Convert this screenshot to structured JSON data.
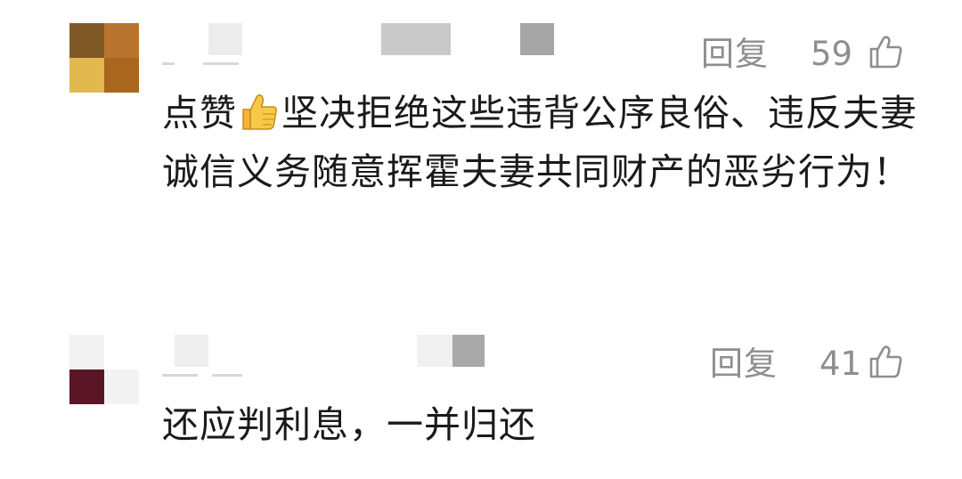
{
  "comments": [
    {
      "avatar_colors": [
        "#7f5a26",
        "#b8742e",
        "#e2b94e",
        "#a8671d"
      ],
      "reply_label": "回复",
      "like_count": "59",
      "text_before_emoji": "点赞",
      "emoji": "thumbs-up-emoji",
      "text_after_emoji": "坚决拒绝这些违背公序良俗、违反夫妻诚信义务随意挥霍夫妻共同财产的恶劣行为！"
    },
    {
      "avatar_colors": [
        "#f2f2f2",
        "#ffffff",
        "#5a1526",
        "#f3f3f3"
      ],
      "reply_label": "回复",
      "like_count": "41",
      "text": "还应判利息，一并归还"
    }
  ],
  "icons": {
    "like": "thumbs-up-outline-icon"
  },
  "colors": {
    "secondary_text": "#8e8e8e",
    "body_text": "#1a1a1a",
    "background": "#ffffff"
  }
}
